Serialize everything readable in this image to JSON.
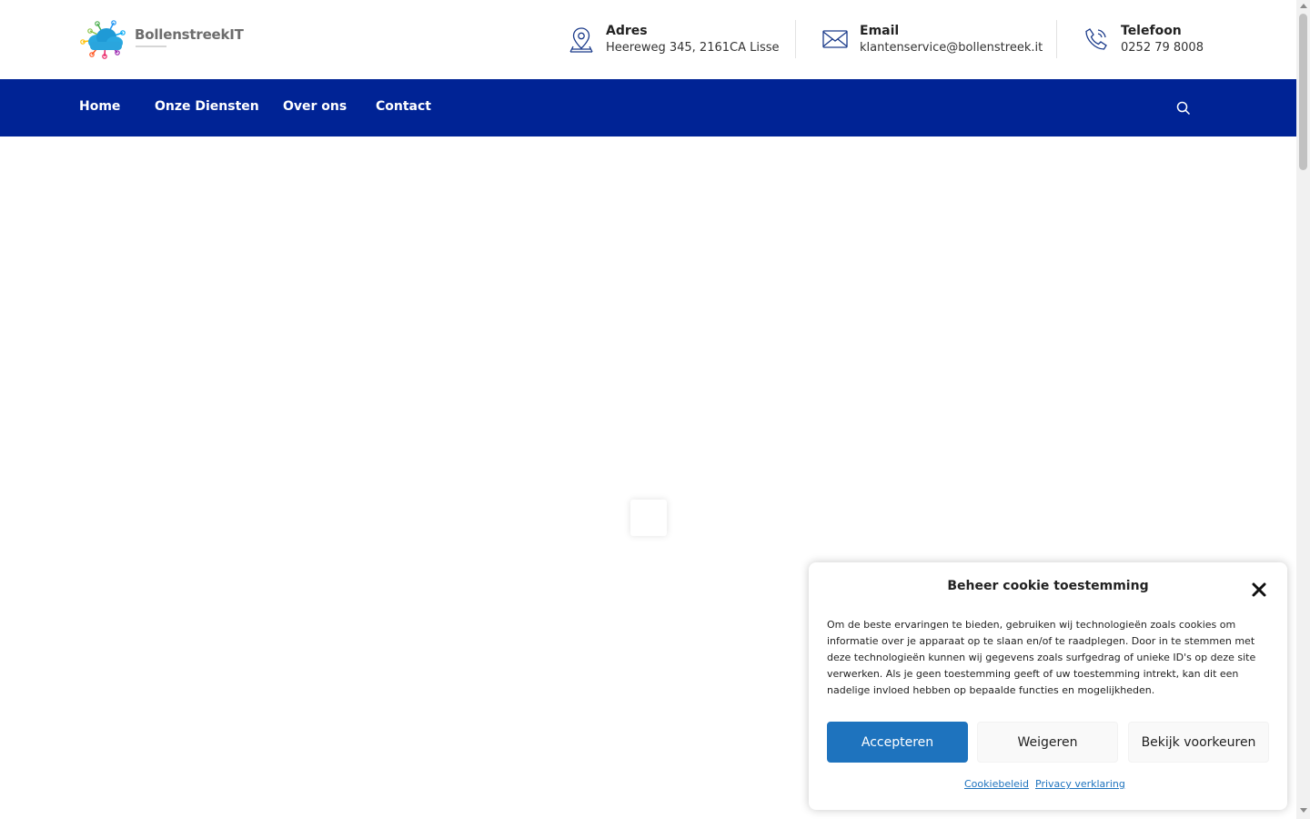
{
  "brand": {
    "name": "BollenstreekIT"
  },
  "header": {
    "address": {
      "title": "Adres",
      "value": "Heereweg 345, 2161CA Lisse",
      "icon": "map-pin-icon"
    },
    "email": {
      "title": "Email",
      "value": "klantenservice@bollenstreek.it",
      "icon": "envelope-icon"
    },
    "phone": {
      "title": "Telefoon",
      "value": "0252 79 8008",
      "icon": "phone-icon"
    }
  },
  "nav": {
    "items": [
      {
        "label": "Home"
      },
      {
        "label": "Onze Diensten"
      },
      {
        "label": "Over ons"
      },
      {
        "label": "Contact"
      }
    ],
    "search_icon": "search-icon"
  },
  "cookie": {
    "title": "Beheer cookie toestemming",
    "text": "Om de beste ervaringen te bieden, gebruiken wij technologieën zoals cookies om informatie over je apparaat op te slaan en/of te raadplegen. Door in te stemmen met deze technologieën kunnen wij gegevens zoals surfgedrag of unieke ID's op deze site verwerken. Als je geen toestemming geeft of uw toestemming intrekt, kan dit een nadelige invloed hebben op bepaalde functies en mogelijkheden.",
    "accept": "Accepteren",
    "deny": "Weigeren",
    "preferences": "Bekijk voorkeuren",
    "links": {
      "cookie_policy": "Cookiebeleid",
      "privacy": "Privacy verklaring"
    }
  },
  "colors": {
    "nav_bg": "#002395",
    "accent": "#1e73be",
    "icon_stroke": "#1a3a8a"
  }
}
